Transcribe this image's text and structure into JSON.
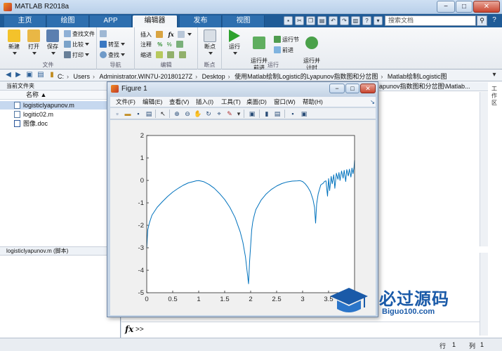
{
  "window": {
    "title": "MATLAB R2018a",
    "min": "−",
    "max": "□",
    "close": "✕"
  },
  "tabs": [
    {
      "label": "主页"
    },
    {
      "label": "绘图"
    },
    {
      "label": "APP"
    },
    {
      "label": "编辑器",
      "active": true
    },
    {
      "label": "发布"
    },
    {
      "label": "视图"
    }
  ],
  "search": {
    "placeholder": "搜索文档",
    "help": "?"
  },
  "ribbon": {
    "file_group": {
      "label": "文件",
      "new": "新建",
      "open": "打开",
      "save": "保存",
      "find_files": "查找文件",
      "compare": "比较",
      "print": "打印"
    },
    "nav_group": {
      "label": "导航",
      "goto": "转至",
      "find": "查找"
    },
    "edit_group": {
      "label": "编辑",
      "insert": "插入",
      "comment": "注释",
      "indent": "缩进",
      "fx": "fx"
    },
    "breakpoint_group": {
      "label": "断点",
      "breakpoints": "断点"
    },
    "run_group": {
      "label": "运行",
      "run": "运行",
      "run_advance": "运行并\n前进",
      "run_section": "运行节",
      "advance": "前进",
      "run_time": "运行并\n计时"
    }
  },
  "address": {
    "crumbs": [
      "C:",
      "Users",
      "Administrator.WIN7U-20180127Z",
      "Desktop",
      "使用Matlab绘制Logistic的Lyapunov指数图和分岔图",
      "Matlab绘制Logistic图"
    ]
  },
  "left_panel": {
    "header": "当前文件夹",
    "column": "名称 ▲",
    "files": [
      {
        "name": "logisticlyapunov.m",
        "selected": true
      },
      {
        "name": "logitic02.m",
        "selected": false
      },
      {
        "name": "图像.doc",
        "selected": false
      }
    ],
    "details": "logisticlyapunov.m  (脚本)"
  },
  "editor": {
    "header_path": "apunov指数图和分岔图\\Matlab...",
    "side_label": "工作区"
  },
  "command": {
    "fx": "fx",
    "prompt": ">>"
  },
  "status": {
    "row_label": "行",
    "row": "1",
    "col_label": "列",
    "col": "1"
  },
  "figure": {
    "title": "Figure 1",
    "menu": [
      "文件(F)",
      "编辑(E)",
      "查看(V)",
      "插入(I)",
      "工具(T)",
      "桌面(D)",
      "窗口(W)",
      "帮助(H)"
    ]
  },
  "watermark": {
    "text": "必过源码",
    "url": "Biguo100.com"
  },
  "chart_data": {
    "type": "line",
    "title": "",
    "xlabel": "",
    "ylabel": "",
    "xlim": [
      0,
      4
    ],
    "ylim": [
      -5,
      2
    ],
    "xticks": [
      "0",
      "0.5",
      "1",
      "1.5",
      "2",
      "2.5",
      "3",
      "3.5"
    ],
    "yticks": [
      "-5",
      "-4",
      "-3",
      "-2",
      "-1",
      "0",
      "1",
      "2"
    ],
    "color": "#0072bd",
    "series": [
      {
        "x": [
          0.0,
          0.02,
          0.05,
          0.1,
          0.2,
          0.3,
          0.4,
          0.5,
          0.6,
          0.7,
          0.8,
          0.9,
          0.95,
          1.0,
          1.05,
          1.1,
          1.2,
          1.3,
          1.4,
          1.5,
          1.6,
          1.7,
          1.8,
          1.85,
          1.9,
          1.93,
          1.96,
          1.98,
          2.0,
          2.02,
          2.04,
          2.07,
          2.1,
          2.2,
          2.3,
          2.4,
          2.5,
          2.6,
          2.7,
          2.8,
          2.9,
          2.95,
          3.0,
          3.05,
          3.1,
          3.15,
          3.2,
          3.23,
          3.25,
          3.27,
          3.3,
          3.35,
          3.4,
          3.42,
          3.45,
          3.48,
          3.5,
          3.52,
          3.55,
          3.57,
          3.6,
          3.62,
          3.65,
          3.68,
          3.7,
          3.72,
          3.75,
          3.78,
          3.8,
          3.83,
          3.85,
          3.88,
          3.9,
          3.93,
          3.95,
          3.97,
          3.99,
          4.0
        ],
        "y": [
          -3.0,
          -2.2,
          -1.9,
          -1.55,
          -1.2,
          -0.95,
          -0.72,
          -0.52,
          -0.36,
          -0.22,
          -0.11,
          -0.05,
          -0.02,
          -0.01,
          -0.03,
          -0.06,
          -0.18,
          -0.35,
          -0.58,
          -0.85,
          -1.2,
          -1.65,
          -2.3,
          -2.75,
          -3.4,
          -4.0,
          -4.6,
          -3.6,
          -2.9,
          -2.2,
          -1.85,
          -1.55,
          -1.3,
          -0.88,
          -0.6,
          -0.4,
          -0.25,
          -0.14,
          -0.07,
          -0.03,
          -0.02,
          -0.01,
          -0.05,
          -0.15,
          -0.3,
          -0.5,
          -0.85,
          -1.2,
          -1.9,
          -1.05,
          -0.6,
          -0.2,
          -0.12,
          -0.05,
          -0.02,
          -0.7,
          0.08,
          -0.45,
          0.18,
          -0.15,
          0.25,
          -0.35,
          0.32,
          0.05,
          0.35,
          0.0,
          0.42,
          0.1,
          0.45,
          -0.05,
          0.48,
          0.2,
          0.5,
          0.15,
          0.55,
          0.3,
          0.6,
          0.9
        ]
      }
    ]
  }
}
